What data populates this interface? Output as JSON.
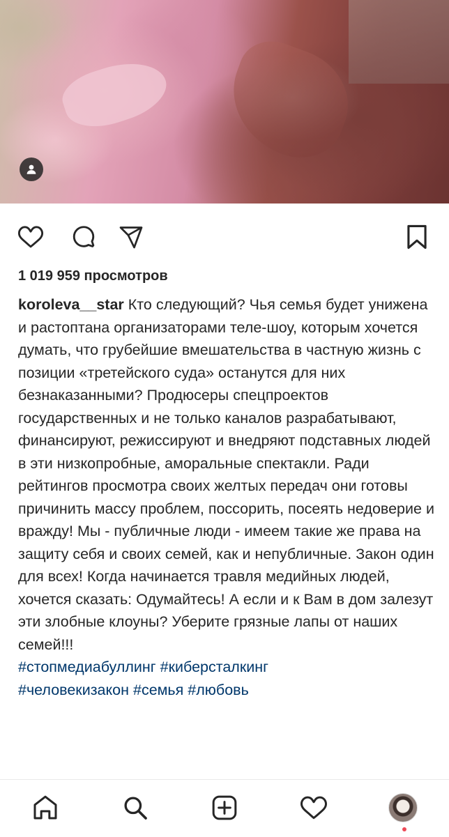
{
  "post": {
    "views": "1 019 959 просмотров",
    "username": "koroleva__star",
    "caption_text": "Кто следующий? Чья семья будет унижена и растоптана организаторами теле-шоу, которым хочется думать, что грубейшие вмешательства в частную жизнь с позиции «третейского суда» останутся для них безнаказанными? Продюсеры спецпроектов государственных и не только каналов разрабатывают, финансируют, режиссируют и внедряют подставных людей в эти низкопробные, аморальные спектакли. Ради рейтингов просмотра своих желтых передач они готовы причинить массу проблем, поссорить, посеять недоверие и вражду!  Мы - публичные люди - имеем такие же права на защиту себя и своих семей, как и непубличные. Закон один для всех! Когда начинается травля медийных людей, хочется сказать: Одумайтесь! А если и к Вам в дом залезут эти злобные клоуны? Уберите грязные лапы от наших семей!!!",
    "hashtags": [
      "#стопмедиабуллинг",
      "#киберсталкинг",
      "#человекизакон",
      "#семья",
      "#любовь"
    ]
  },
  "icons": {
    "user_tag": "person-icon",
    "like": "heart-icon",
    "comment": "comment-icon",
    "share": "send-icon",
    "save": "bookmark-icon",
    "home": "home-icon",
    "search": "search-icon",
    "create": "add-icon",
    "activity": "heart-icon",
    "profile": "avatar"
  },
  "colors": {
    "text": "#262626",
    "hashtag": "#00376b",
    "notification": "#ed4956"
  }
}
